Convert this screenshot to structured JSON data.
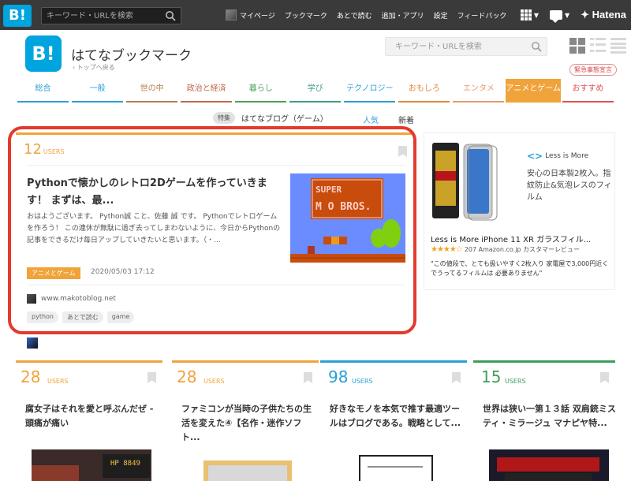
{
  "topbar": {
    "logo": "B!",
    "search_placeholder": "キーワード・URLを検索",
    "nav": [
      "マイページ",
      "ブックマーク",
      "あとで読む",
      "追加・アプリ",
      "設定",
      "フィードバック"
    ],
    "hatena": "Hatena"
  },
  "header": {
    "logo": "B!",
    "title": "はてなブックマーク",
    "back_link": "‹  トップへ戻る",
    "search_placeholder": "キーワード・URLを検索"
  },
  "tabs": [
    {
      "label": "総合",
      "color": "#2a9fd6"
    },
    {
      "label": "一般",
      "color": "#2a9fd6"
    },
    {
      "label": "世の中",
      "color": "#b5814a"
    },
    {
      "label": "政治と経済",
      "color": "#c0684a"
    },
    {
      "label": "暮らし",
      "color": "#4aa05a"
    },
    {
      "label": "学び",
      "color": "#3c9e8c"
    },
    {
      "label": "テクノロジー",
      "color": "#2a9fd6"
    },
    {
      "label": "おもしろ",
      "color": "#e0883a"
    },
    {
      "label": "エンタメ",
      "color": "#e89b6a"
    },
    {
      "label": "アニメとゲーム",
      "color": "#f1a33b",
      "active": true
    },
    {
      "label": "おすすめ",
      "color": "#e05050"
    }
  ],
  "emergency_badge": "緊急事態宣言",
  "subheader": {
    "badge": "特集",
    "title": "はてなブログ（ゲーム）",
    "tab_popular": "人気",
    "tab_new": "新着"
  },
  "main_entry": {
    "users_count": "12",
    "users_label": "USERS",
    "title": "Pythonで懐かしのレトロ2Dゲームを作っていきます！ まずは、最...",
    "description": "おはようございます。 Python誠 こと、佐藤 誠 です。 Pythonでレトロゲームを作ろう！ この連休が無駄に過ぎ去ってしまわないように、今日からPythonの記事をできるだけ毎日アップしていきたいと思います。（・...",
    "category": "アニメとゲーム",
    "date": "2020/05/03 17:12",
    "domain": "www.makotoblog.net",
    "tags": [
      "python",
      "あとで読む",
      "game"
    ],
    "thumb_text_1": "SUPER",
    "thumb_text_2": "M  O BROS."
  },
  "ad": {
    "brand": "Less is More",
    "copy": "安心の日本製2枚入。指紋防止&気泡レスのフィルム",
    "title": "Less is More iPhone 11 XR ガラスフィル...",
    "stars": "★★★★☆",
    "rating_meta": "207 Amazon.co.jp カスタマーレビュー",
    "review": "\"この値段で、とても扱いやすく2枚入り 家電屋で3,000円近くでうってるフィルムは 必要ありません\""
  },
  "cards": [
    {
      "users": "28",
      "users_label": "USERS",
      "color": "#f1a33b",
      "title": "腐女子はそれを愛と呼ぶんだぜ - 頭痛が痛い"
    },
    {
      "users": "28",
      "users_label": "USERS",
      "color": "#f1a33b",
      "title": "ファミコンが当時の子供たちの生活を変えた④【名作・迷作ソフト..."
    },
    {
      "users": "98",
      "users_label": "USERS",
      "color": "#2a9fd6",
      "title": "好きなモノを本気で推す最適ツールはブログである。戦略として..."
    },
    {
      "users": "15",
      "users_label": "USERS",
      "color": "#3c9e5c",
      "title": "世界は狭い一第１３話 双肩銃ミスティ・ミラージュ マナピヤ特..."
    }
  ]
}
